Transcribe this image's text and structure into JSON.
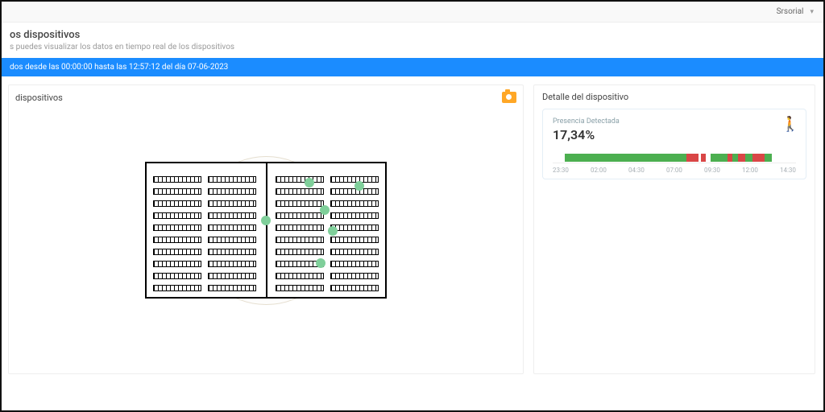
{
  "topbar": {
    "user": "Srsorial"
  },
  "page": {
    "title": "os dispositivos",
    "subtitle": "s puedes visualizar los datos en tiempo real de los dispositivos"
  },
  "blue_bar": "dos desde las 00:00:00 hasta las 12:57:12 del día 07-06-2023",
  "left_panel": {
    "title": "dispositivos"
  },
  "right_panel": {
    "title": "Detalle del dispositivo",
    "card_label": "Presencia Detectada",
    "card_value": "17,34%"
  },
  "chart_data": {
    "type": "bar",
    "title": "Presencia Detectada",
    "ylabel": "",
    "x_ticks": [
      "23:30",
      "02:00",
      "04:30",
      "07:00",
      "09:30",
      "12:00",
      "14:30"
    ],
    "series": [
      {
        "name": "presence-green",
        "color": "#4caf50",
        "segments": [
          [
            5,
            55
          ],
          [
            65,
            72
          ],
          [
            74,
            76
          ],
          [
            79,
            82
          ],
          [
            87,
            90
          ]
        ]
      },
      {
        "name": "presence-red",
        "color": "#d94646",
        "segments": [
          [
            55,
            60
          ],
          [
            61,
            63
          ],
          [
            72,
            74
          ],
          [
            76,
            79
          ],
          [
            82,
            87
          ]
        ]
      }
    ]
  }
}
